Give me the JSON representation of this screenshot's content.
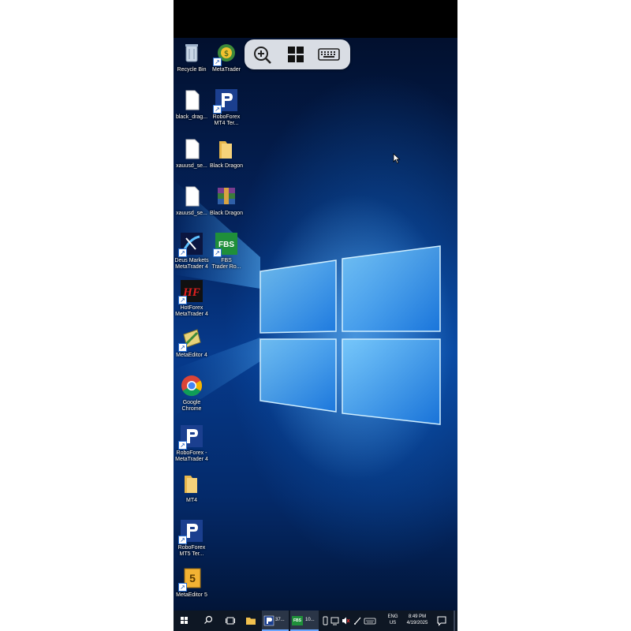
{
  "desktop_icons": [
    {
      "label": "Recycle Bin",
      "icon": "recycle-bin-icon"
    },
    {
      "label": "MetaTrader",
      "icon": "metatrader-icon"
    },
    {
      "label": "black_drag...",
      "icon": "document-icon"
    },
    {
      "label": "RoboForex\nMT4 Ter...",
      "icon": "roboforex-icon"
    },
    {
      "label": "xauusd_se...",
      "icon": "document-icon"
    },
    {
      "label": "Black Dragon",
      "icon": "folder-icon"
    },
    {
      "label": "xauusd_se...",
      "icon": "document-icon"
    },
    {
      "label": "Black Dragon",
      "icon": "winrar-archive-icon"
    },
    {
      "label": "Deus Markets\nMetaTrader 4",
      "icon": "deus-markets-icon"
    },
    {
      "label": "FBS\nTrader Ro...",
      "icon": "fbs-icon"
    },
    {
      "label": "HotForex\nMetaTrader 4",
      "icon": "hotforex-icon"
    },
    {
      "label": "MetaEditor 4",
      "icon": "metaeditor4-icon"
    },
    {
      "label": "Google\nChrome",
      "icon": "chrome-icon"
    },
    {
      "label": "RoboForex -\nMetaTrader 4",
      "icon": "roboforex-icon"
    },
    {
      "label": "MT4",
      "icon": "folder-icon"
    },
    {
      "label": "RoboForex\nMT5 Ter...",
      "icon": "roboforex-icon"
    },
    {
      "label": "MetaEditor 5",
      "icon": "metaeditor5-icon"
    }
  ],
  "overlay_toolbar": {
    "buttons": [
      "zoom-in-icon",
      "windows-logo-icon",
      "keyboard-icon"
    ]
  },
  "taskbar": {
    "task_items": [
      {
        "label": "37...",
        "icon": "roboforex-icon"
      },
      {
        "label": "10...",
        "icon": "fbs-icon"
      }
    ],
    "fbs_badge": "FBS",
    "language": "ENG",
    "region": "US",
    "time": "8:49 PM",
    "date": "4/19/2025"
  },
  "colors": {
    "taskbar_bg": "#0e1724",
    "desktop_accent": "#1e8cff",
    "fbs_green": "#1f8f3a"
  }
}
